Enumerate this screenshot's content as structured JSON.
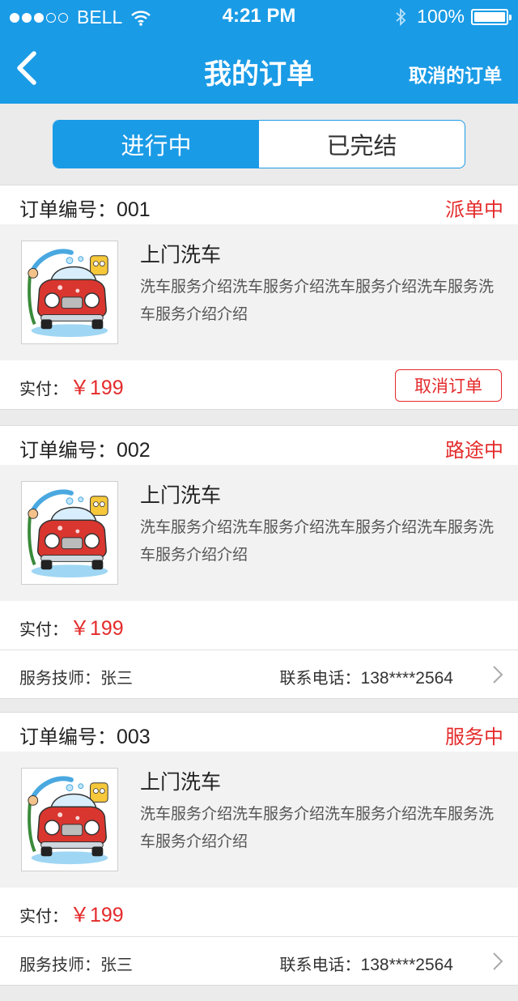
{
  "status_bar": {
    "carrier": "BELL",
    "time": "4:21 PM",
    "battery": "100%",
    "battery_level": 1.0
  },
  "nav": {
    "title": "我的订单",
    "right_action": "取消的订单"
  },
  "tabs": [
    {
      "label": "进行中",
      "active": true
    },
    {
      "label": "已完结",
      "active": false
    }
  ],
  "orders": [
    {
      "no_label": "订单编号：",
      "no": "001",
      "status": "派单中",
      "service_title": "上门洗车",
      "service_desc": "洗车服务介绍洗车服务介绍洗车服务介绍洗车服务洗车服务介绍介绍",
      "pay_label": "实付：",
      "price": "￥199",
      "cancel_label": "取消订单"
    },
    {
      "no_label": "订单编号：",
      "no": "002",
      "status": "路途中",
      "service_title": "上门洗车",
      "service_desc": "洗车服务介绍洗车服务介绍洗车服务介绍洗车服务洗车服务介绍介绍",
      "pay_label": "实付：",
      "price": "￥199",
      "technician": "服务技师：张三",
      "phone_label": "联系电话：",
      "phone": "138****2564"
    },
    {
      "no_label": "订单编号：",
      "no": "003",
      "status": "服务中",
      "service_title": "上门洗车",
      "service_desc": "洗车服务介绍洗车服务介绍洗车服务介绍洗车服务洗车服务介绍介绍",
      "pay_label": "实付：",
      "price": "￥199",
      "technician": "服务技师：张三",
      "phone_label": "联系电话：",
      "phone": "138****2564"
    }
  ],
  "icons": {
    "back": "back-chevron-icon",
    "row_arrow": "chevron-right-icon",
    "wifi": "wifi-icon",
    "bluetooth": "bluetooth-icon"
  },
  "colors": {
    "brand": "#1a9be6",
    "status": "#e42a2a",
    "body_bg": "#f2f2f2"
  }
}
